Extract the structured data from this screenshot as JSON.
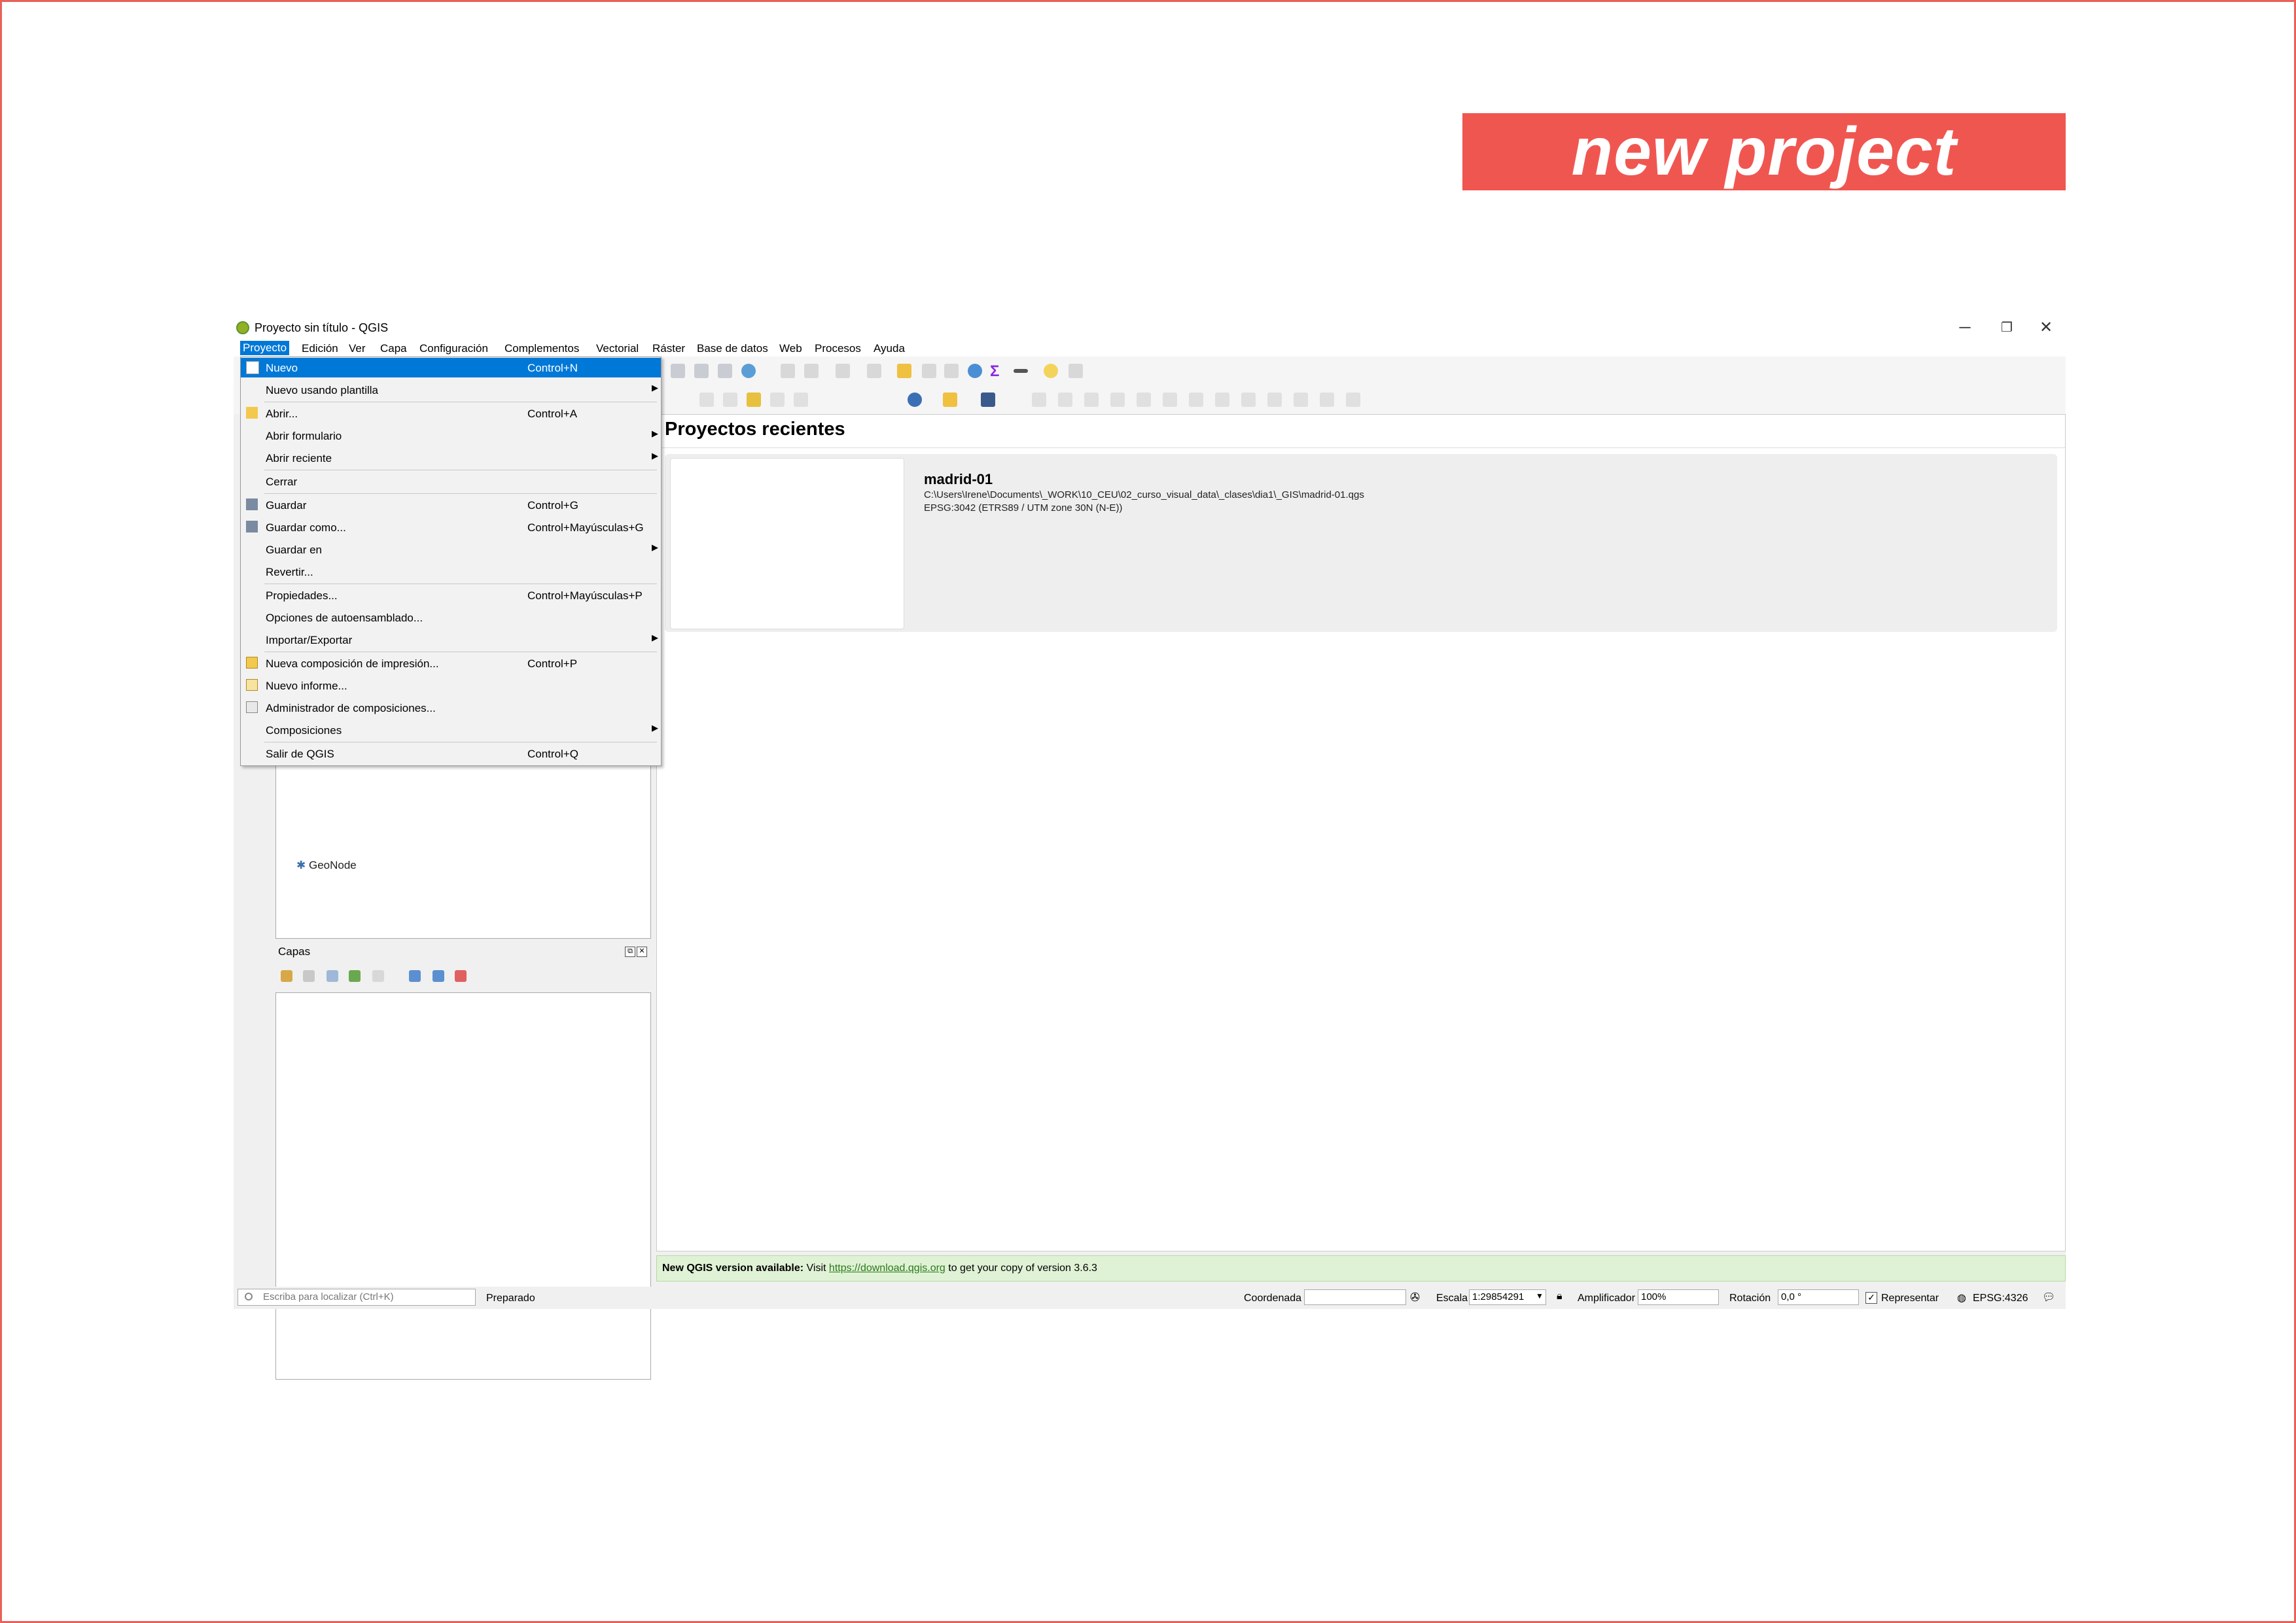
{
  "banner": {
    "text": "new project"
  },
  "window": {
    "title": "Proyecto sin título - QGIS",
    "controls": {
      "minimize": "─",
      "restore": "❐",
      "close": "✕"
    }
  },
  "menubar": {
    "items": [
      "Proyecto",
      "Edición",
      "Ver",
      "Capa",
      "Configuración",
      "Complementos",
      "Vectorial",
      "Ráster",
      "Base de datos",
      "Web",
      "Procesos",
      "Ayuda"
    ]
  },
  "project_menu": {
    "items": [
      {
        "label": "Nuevo",
        "shortcut": "Control+N",
        "icon": "new-file-icon"
      },
      {
        "label": "Nuevo usando plantilla",
        "shortcut": "",
        "submenu": true
      },
      {
        "label": "Abrir...",
        "shortcut": "Control+A",
        "icon": "folder-icon"
      },
      {
        "label": "Abrir formulario",
        "shortcut": "",
        "submenu": true
      },
      {
        "label": "Abrir reciente",
        "shortcut": "",
        "submenu": true
      },
      {
        "label": "Cerrar",
        "shortcut": ""
      },
      {
        "label": "Guardar",
        "shortcut": "Control+G",
        "icon": "save-icon"
      },
      {
        "label": "Guardar como...",
        "shortcut": "Control+Mayúsculas+G",
        "icon": "save-as-icon"
      },
      {
        "label": "Guardar en",
        "shortcut": "",
        "submenu": true
      },
      {
        "label": "Revertir...",
        "shortcut": ""
      },
      {
        "label": "Propiedades...",
        "shortcut": "Control+Mayúsculas+P"
      },
      {
        "label": "Opciones de autoensamblado...",
        "shortcut": ""
      },
      {
        "label": "Importar/Exportar",
        "shortcut": "",
        "submenu": true
      },
      {
        "label": "Nueva composición de impresión...",
        "shortcut": "Control+P",
        "icon": "print-layout-icon"
      },
      {
        "label": "Nuevo informe...",
        "shortcut": "",
        "icon": "report-icon"
      },
      {
        "label": "Administrador de composiciones...",
        "shortcut": "",
        "icon": "layout-manager-icon"
      },
      {
        "label": "Composiciones",
        "shortcut": "",
        "submenu": true
      },
      {
        "label": "Salir de QGIS",
        "shortcut": "Control+Q"
      }
    ]
  },
  "browser_panel": {
    "visible_item": "GeoNode"
  },
  "layers_panel": {
    "title": "Capas"
  },
  "recent_projects": {
    "title": "Proyectos recientes",
    "items": [
      {
        "name": "madrid-01",
        "path": "C:\\Users\\Irene\\Documents\\_WORK\\10_CEU\\02_curso_visual_data\\_clases\\dia1\\_GIS\\madrid-01.qgs",
        "crs": "EPSG:3042 (ETRS89 / UTM zone 30N (N-E))"
      }
    ]
  },
  "new_version": {
    "bold": "New QGIS version available:",
    "pre": " Visit ",
    "link": "https://download.qgis.org",
    "post": " to get your copy of version 3.6.3"
  },
  "statusbar": {
    "locate_placeholder": "Escriba para localizar (Ctrl+K)",
    "ready": "Preparado",
    "coord_label": "Coordenada",
    "coord_value": "",
    "scale_label": "Escala",
    "scale_value": "1:29854291",
    "magnifier_label": "Amplificador",
    "magnifier_value": "100%",
    "rotation_label": "Rotación",
    "rotation_value": "0,0 °",
    "render_label": "Representar",
    "crs": "EPSG:4326"
  },
  "colors": {
    "accent": "#f05650",
    "selection": "#0078d7",
    "notice_bg": "#e0f2d6"
  }
}
